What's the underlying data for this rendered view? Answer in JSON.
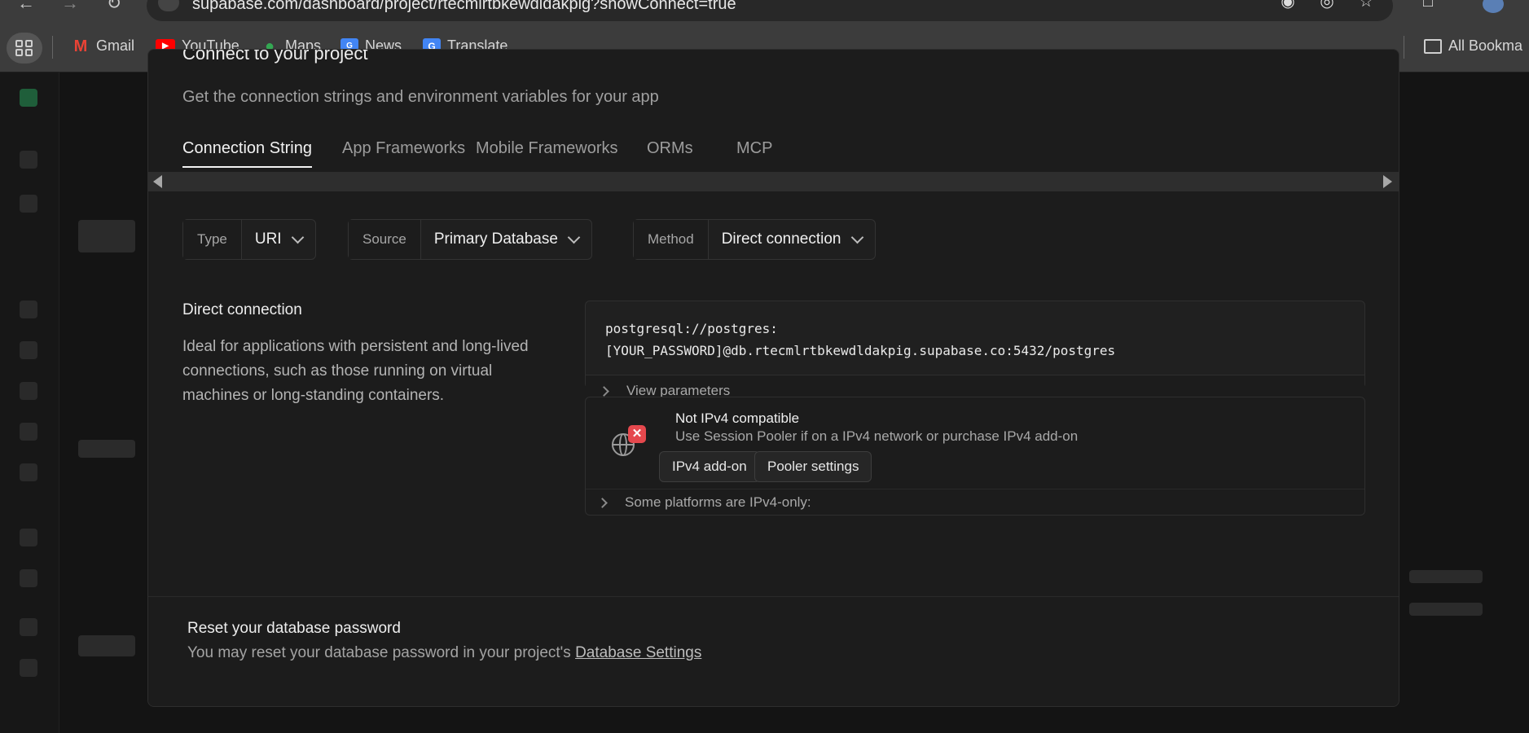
{
  "browser": {
    "url": "supabase.com/dashboard/project/rtecmlrtbkewdldakpig?showConnect=true",
    "bookmarks": [
      {
        "label": "Gmail",
        "icon": "gmail-icon"
      },
      {
        "label": "YouTube",
        "icon": "youtube-icon"
      },
      {
        "label": "Maps",
        "icon": "maps-icon"
      },
      {
        "label": "News",
        "icon": "news-icon"
      },
      {
        "label": "Translate",
        "icon": "translate-icon"
      }
    ],
    "all_bookmarks": "All Bookma"
  },
  "modal": {
    "title": "Connect to your project",
    "subtitle": "Get the connection strings and environment variables for your app",
    "tabs": [
      {
        "label": "Connection String",
        "active": true
      },
      {
        "label": "App Frameworks",
        "active": false
      },
      {
        "label": "Mobile Frameworks",
        "active": false
      },
      {
        "label": "ORMs",
        "active": false
      },
      {
        "label": "MCP",
        "active": false
      }
    ],
    "selects": {
      "type": {
        "label": "Type",
        "value": "URI"
      },
      "source": {
        "label": "Source",
        "value": "Primary Database"
      },
      "method": {
        "label": "Method",
        "value": "Direct connection"
      }
    },
    "connection": {
      "title": "Direct connection",
      "description": "Ideal for applications with persistent and long-lived connections, such as those running on virtual machines or long-standing containers.",
      "code_line1": "postgresql://postgres:",
      "code_line2": "[YOUR_PASSWORD]@db.rtecmlrtbkewdldakpig.supabase.co:5432/postgres",
      "view_parameters": "View parameters"
    },
    "ipv4": {
      "title": "Not IPv4 compatible",
      "description": "Use Session Pooler if on a IPv4 network or purchase IPv4 add-on",
      "addon_button": "IPv4 add-on",
      "pooler_button": "Pooler settings",
      "platforms": "Some platforms are IPv4-only:"
    },
    "reset": {
      "title": "Reset your database password",
      "description": "You may reset your database password in your project's ",
      "link": "Database Settings"
    }
  },
  "colors": {
    "modal_bg": "#1c1c1c",
    "error_badge": "#e5484d"
  }
}
